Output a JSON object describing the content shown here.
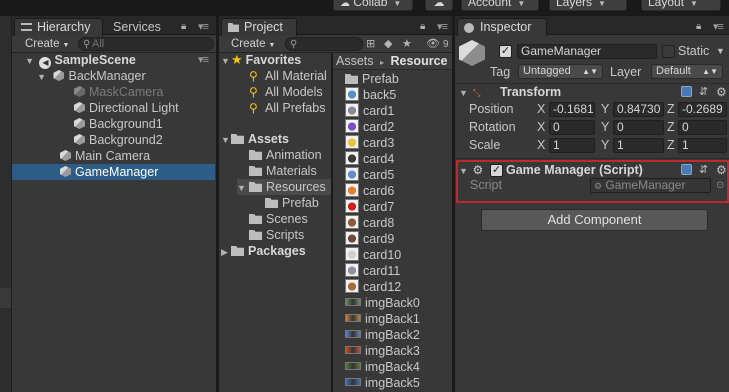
{
  "toolbar": {
    "collab": "Collab",
    "account": "Account",
    "layers": "Layers",
    "layout": "Layout"
  },
  "hierarchy": {
    "tab": "Hierarchy",
    "services_tab": "Services",
    "create": "Create",
    "search_placeholder": "All",
    "scene": "SampleScene",
    "items": [
      {
        "label": "BackManager"
      },
      {
        "label": "MaskCamera"
      },
      {
        "label": "Directional Light"
      },
      {
        "label": "Background1"
      },
      {
        "label": "Background2"
      },
      {
        "label": "Main Camera"
      },
      {
        "label": "GameManager"
      }
    ]
  },
  "project": {
    "tab": "Project",
    "create": "Create",
    "search_badge": "9",
    "favorites": {
      "label": "Favorites",
      "items": [
        "All Material",
        "All Models",
        "All Prefabs"
      ]
    },
    "assets": {
      "label": "Assets",
      "items": [
        "Animation",
        "Materials",
        "Resources",
        "Prefab",
        "Scenes",
        "Scripts"
      ]
    },
    "packages": "Packages",
    "breadcrumb": {
      "root": "Assets",
      "separator": "▸",
      "current": "Resource"
    },
    "files": [
      {
        "label": "Prefab",
        "kind": "folder"
      },
      {
        "label": "back5",
        "kind": "image",
        "color": "#5b8fc0"
      },
      {
        "label": "card1",
        "kind": "image",
        "color": "#8a8a9a"
      },
      {
        "label": "card2",
        "kind": "image",
        "color": "#7a4fc0"
      },
      {
        "label": "card3",
        "kind": "image",
        "color": "#e7c43a"
      },
      {
        "label": "card4",
        "kind": "image",
        "color": "#3a3a3a"
      },
      {
        "label": "card5",
        "kind": "image",
        "color": "#6a8ad0"
      },
      {
        "label": "card6",
        "kind": "image",
        "color": "#e08030"
      },
      {
        "label": "card7",
        "kind": "image",
        "color": "#d02020"
      },
      {
        "label": "card8",
        "kind": "image",
        "color": "#8a5a3a"
      },
      {
        "label": "card9",
        "kind": "image",
        "color": "#6a4a3a"
      },
      {
        "label": "card10",
        "kind": "image",
        "color": "#d0d0d0"
      },
      {
        "label": "card11",
        "kind": "image",
        "color": "#9090a0"
      },
      {
        "label": "card12",
        "kind": "image",
        "color": "#a06a3a"
      },
      {
        "label": "imgBack0",
        "kind": "strip",
        "color": "#6a8a6a"
      },
      {
        "label": "imgBack1",
        "kind": "strip",
        "color": "#c08040"
      },
      {
        "label": "imgBack2",
        "kind": "strip",
        "color": "#6080c0"
      },
      {
        "label": "imgBack3",
        "kind": "strip",
        "color": "#c05030"
      },
      {
        "label": "imgBack4",
        "kind": "strip",
        "color": "#5a7a3a"
      },
      {
        "label": "imgBack5",
        "kind": "strip",
        "color": "#4070b0"
      }
    ]
  },
  "inspector": {
    "tab": "Inspector",
    "object_name": "GameManager",
    "static_label": "Static",
    "tag_label": "Tag",
    "tag_value": "Untagged",
    "layer_label": "Layer",
    "layer_value": "Default",
    "transform": {
      "title": "Transform",
      "position_label": "Position",
      "rotation_label": "Rotation",
      "scale_label": "Scale",
      "x": "X",
      "y": "Y",
      "z": "Z",
      "position": [
        "-0.1681",
        "0.84730",
        "-0.2689"
      ],
      "rotation": [
        "0",
        "0",
        "0"
      ],
      "scale": [
        "1",
        "1",
        "1"
      ]
    },
    "script_component": {
      "title": "Game Manager (Script)",
      "script_label": "Script",
      "script_value": "GameManager",
      "highlight_color": "#c0292b"
    },
    "add_component": "Add Component"
  }
}
